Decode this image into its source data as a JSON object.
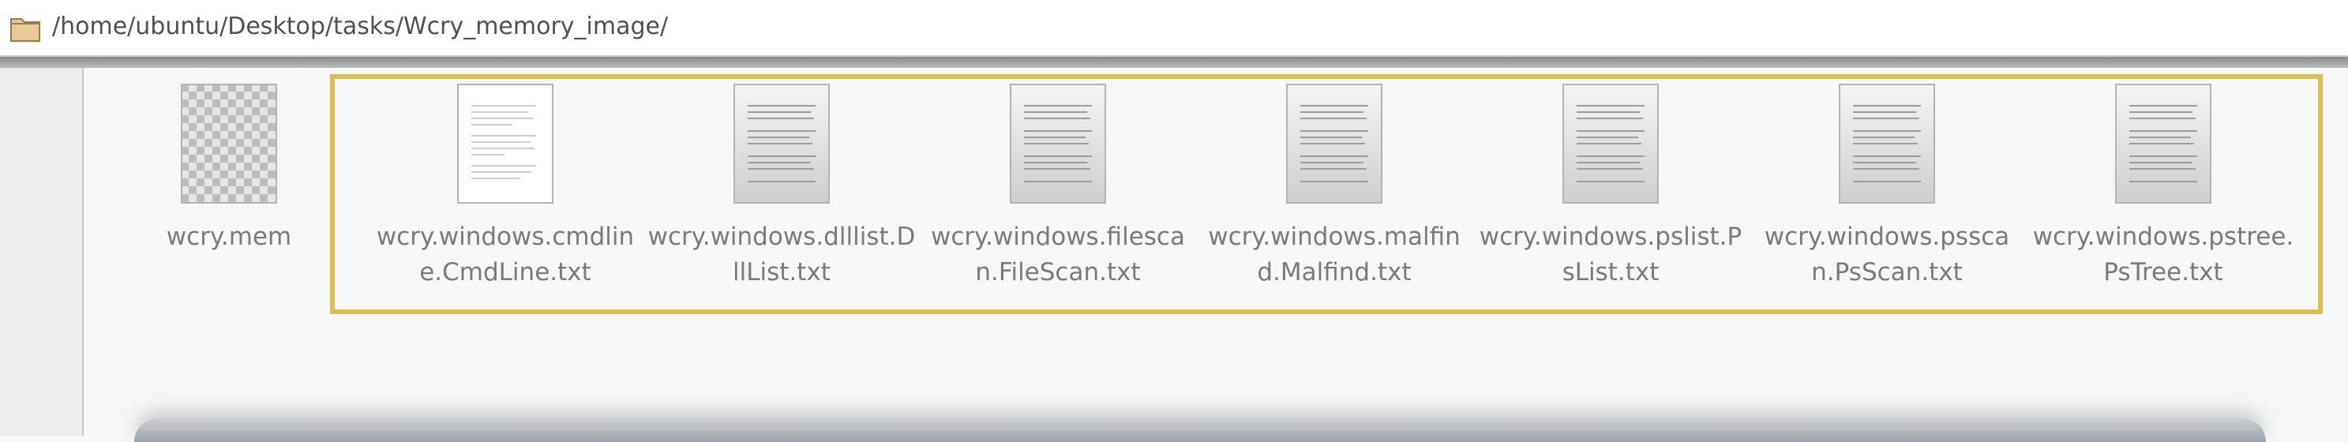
{
  "location_bar": {
    "path": "/home/ubuntu/Desktop/tasks/Wcry_memory_image/",
    "icon": "folder-icon"
  },
  "files": [
    {
      "name": "wcry.mem",
      "icon": "binary-file-icon"
    },
    {
      "name": "wcry.windows.cmdline.CmdLine.txt",
      "icon": "text-file-icon"
    },
    {
      "name": "wcry.windows.dlllist.DllList.txt",
      "icon": "text-file-icon"
    },
    {
      "name": "wcry.windows.filescan.FileScan.txt",
      "icon": "text-file-icon"
    },
    {
      "name": "wcry.windows.malfind.Malfind.txt",
      "icon": "text-file-icon"
    },
    {
      "name": "wcry.windows.pslist.PsList.txt",
      "icon": "text-file-icon"
    },
    {
      "name": "wcry.windows.psscan.PsScan.txt",
      "icon": "text-file-icon"
    },
    {
      "name": "wcry.windows.pstree.PsTree.txt",
      "icon": "text-file-icon"
    }
  ],
  "colors": {
    "highlight": "#d9bd55",
    "filename_text": "#7a7a7a"
  }
}
